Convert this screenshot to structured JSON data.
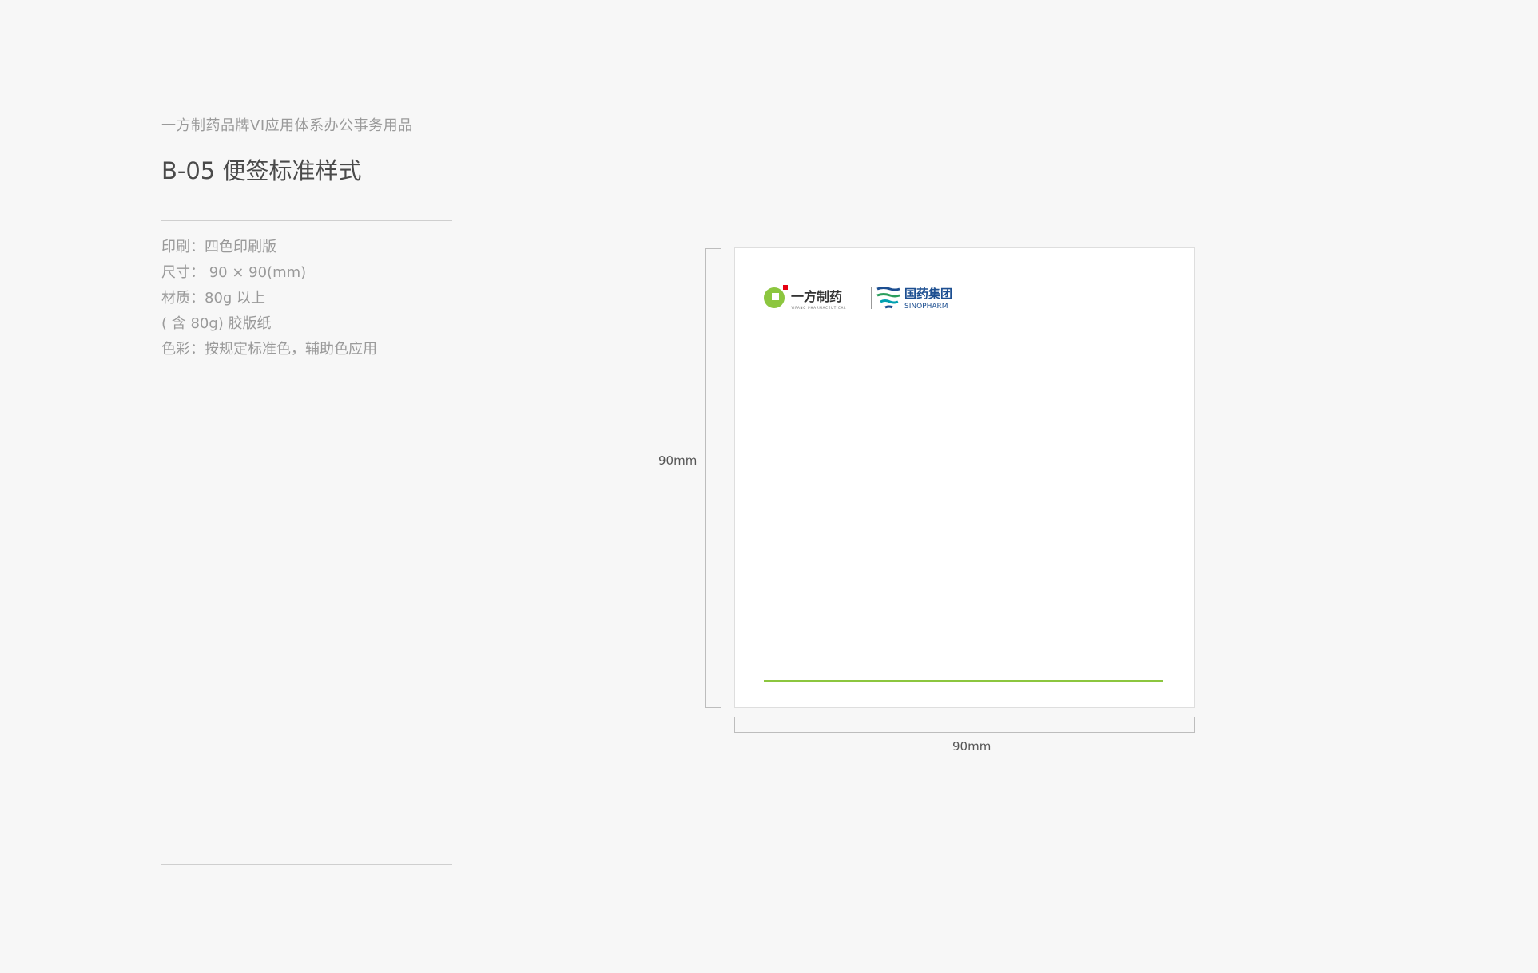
{
  "header": {
    "subtitle": "一方制药品牌VI应用体系办公事务用品",
    "title": "B-05 便签标准样式"
  },
  "specs": [
    "印刷：四色印刷版",
    "尺寸：  90 × 90(mm)",
    "材质：80g 以上",
    "( 含 80g) 胶版纸",
    "色彩：按规定标准色，辅助色应用"
  ],
  "note": {
    "accent_color": "#8cc63f",
    "logo_left": {
      "name": "一方制药",
      "tagline": "YIFANG PHARMACEUTICAL"
    },
    "logo_right": {
      "name": "国药集团",
      "tagline": "SINOPHARM"
    }
  },
  "dimensions": {
    "height_label": "90mm",
    "width_label": "90mm"
  }
}
